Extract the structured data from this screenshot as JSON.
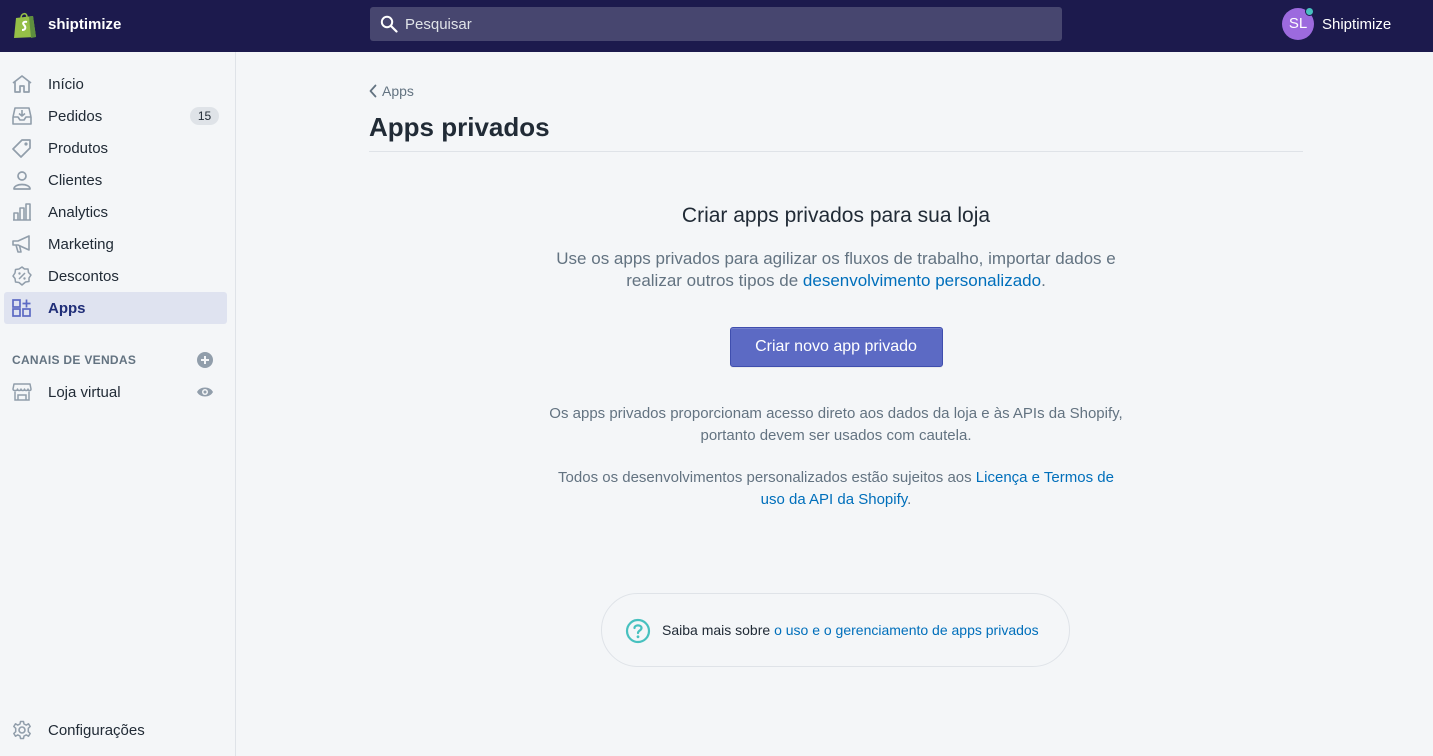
{
  "topbar": {
    "store_name": "shiptimize",
    "search_placeholder": "Pesquisar",
    "user_initials": "SL",
    "user_name": "Shiptimize",
    "colors": {
      "background": "#1c1a4d",
      "avatar": "#9c6ade",
      "status": "#47c1bf"
    }
  },
  "sidebar": {
    "items": [
      {
        "label": "Início",
        "icon": "home-icon"
      },
      {
        "label": "Pedidos",
        "icon": "orders-icon",
        "badge": "15"
      },
      {
        "label": "Produtos",
        "icon": "tag-icon"
      },
      {
        "label": "Clientes",
        "icon": "person-icon"
      },
      {
        "label": "Analytics",
        "icon": "bar-chart-icon"
      },
      {
        "label": "Marketing",
        "icon": "megaphone-icon"
      },
      {
        "label": "Descontos",
        "icon": "discount-icon"
      },
      {
        "label": "Apps",
        "icon": "apps-icon",
        "active": true
      }
    ],
    "sales_channels_title": "CANAIS DE VENDAS",
    "channels": [
      {
        "label": "Loja virtual",
        "icon": "store-icon"
      }
    ],
    "settings_label": "Configurações"
  },
  "main": {
    "breadcrumb": "Apps",
    "title": "Apps privados",
    "empty_state": {
      "heading": "Criar apps privados para sua loja",
      "lead_text": "Use os apps privados para agilizar os fluxos de trabalho, importar dados e realizar outros tipos de ",
      "lead_link": "desenvolvimento personalizado",
      "lead_end": ".",
      "button_label": "Criar novo app privado",
      "note1": "Os apps privados proporcionam acesso direto aos dados da loja e às APIs da Shopify, portanto devem ser usados com cautela.",
      "note2_text": "Todos os desenvolvimentos personalizados estão sujeitos aos ",
      "note2_link": "Licença e Termos de uso da API da Shopify",
      "note2_end": "."
    },
    "help": {
      "text": "Saiba mais sobre ",
      "link": "o uso e o gerenciamento de apps privados",
      "icon": "question-circle-icon"
    }
  },
  "colors": {
    "primary": "#5c6ac4",
    "link": "#006fbb",
    "muted_text": "#637381",
    "active_nav": "#202e78"
  }
}
